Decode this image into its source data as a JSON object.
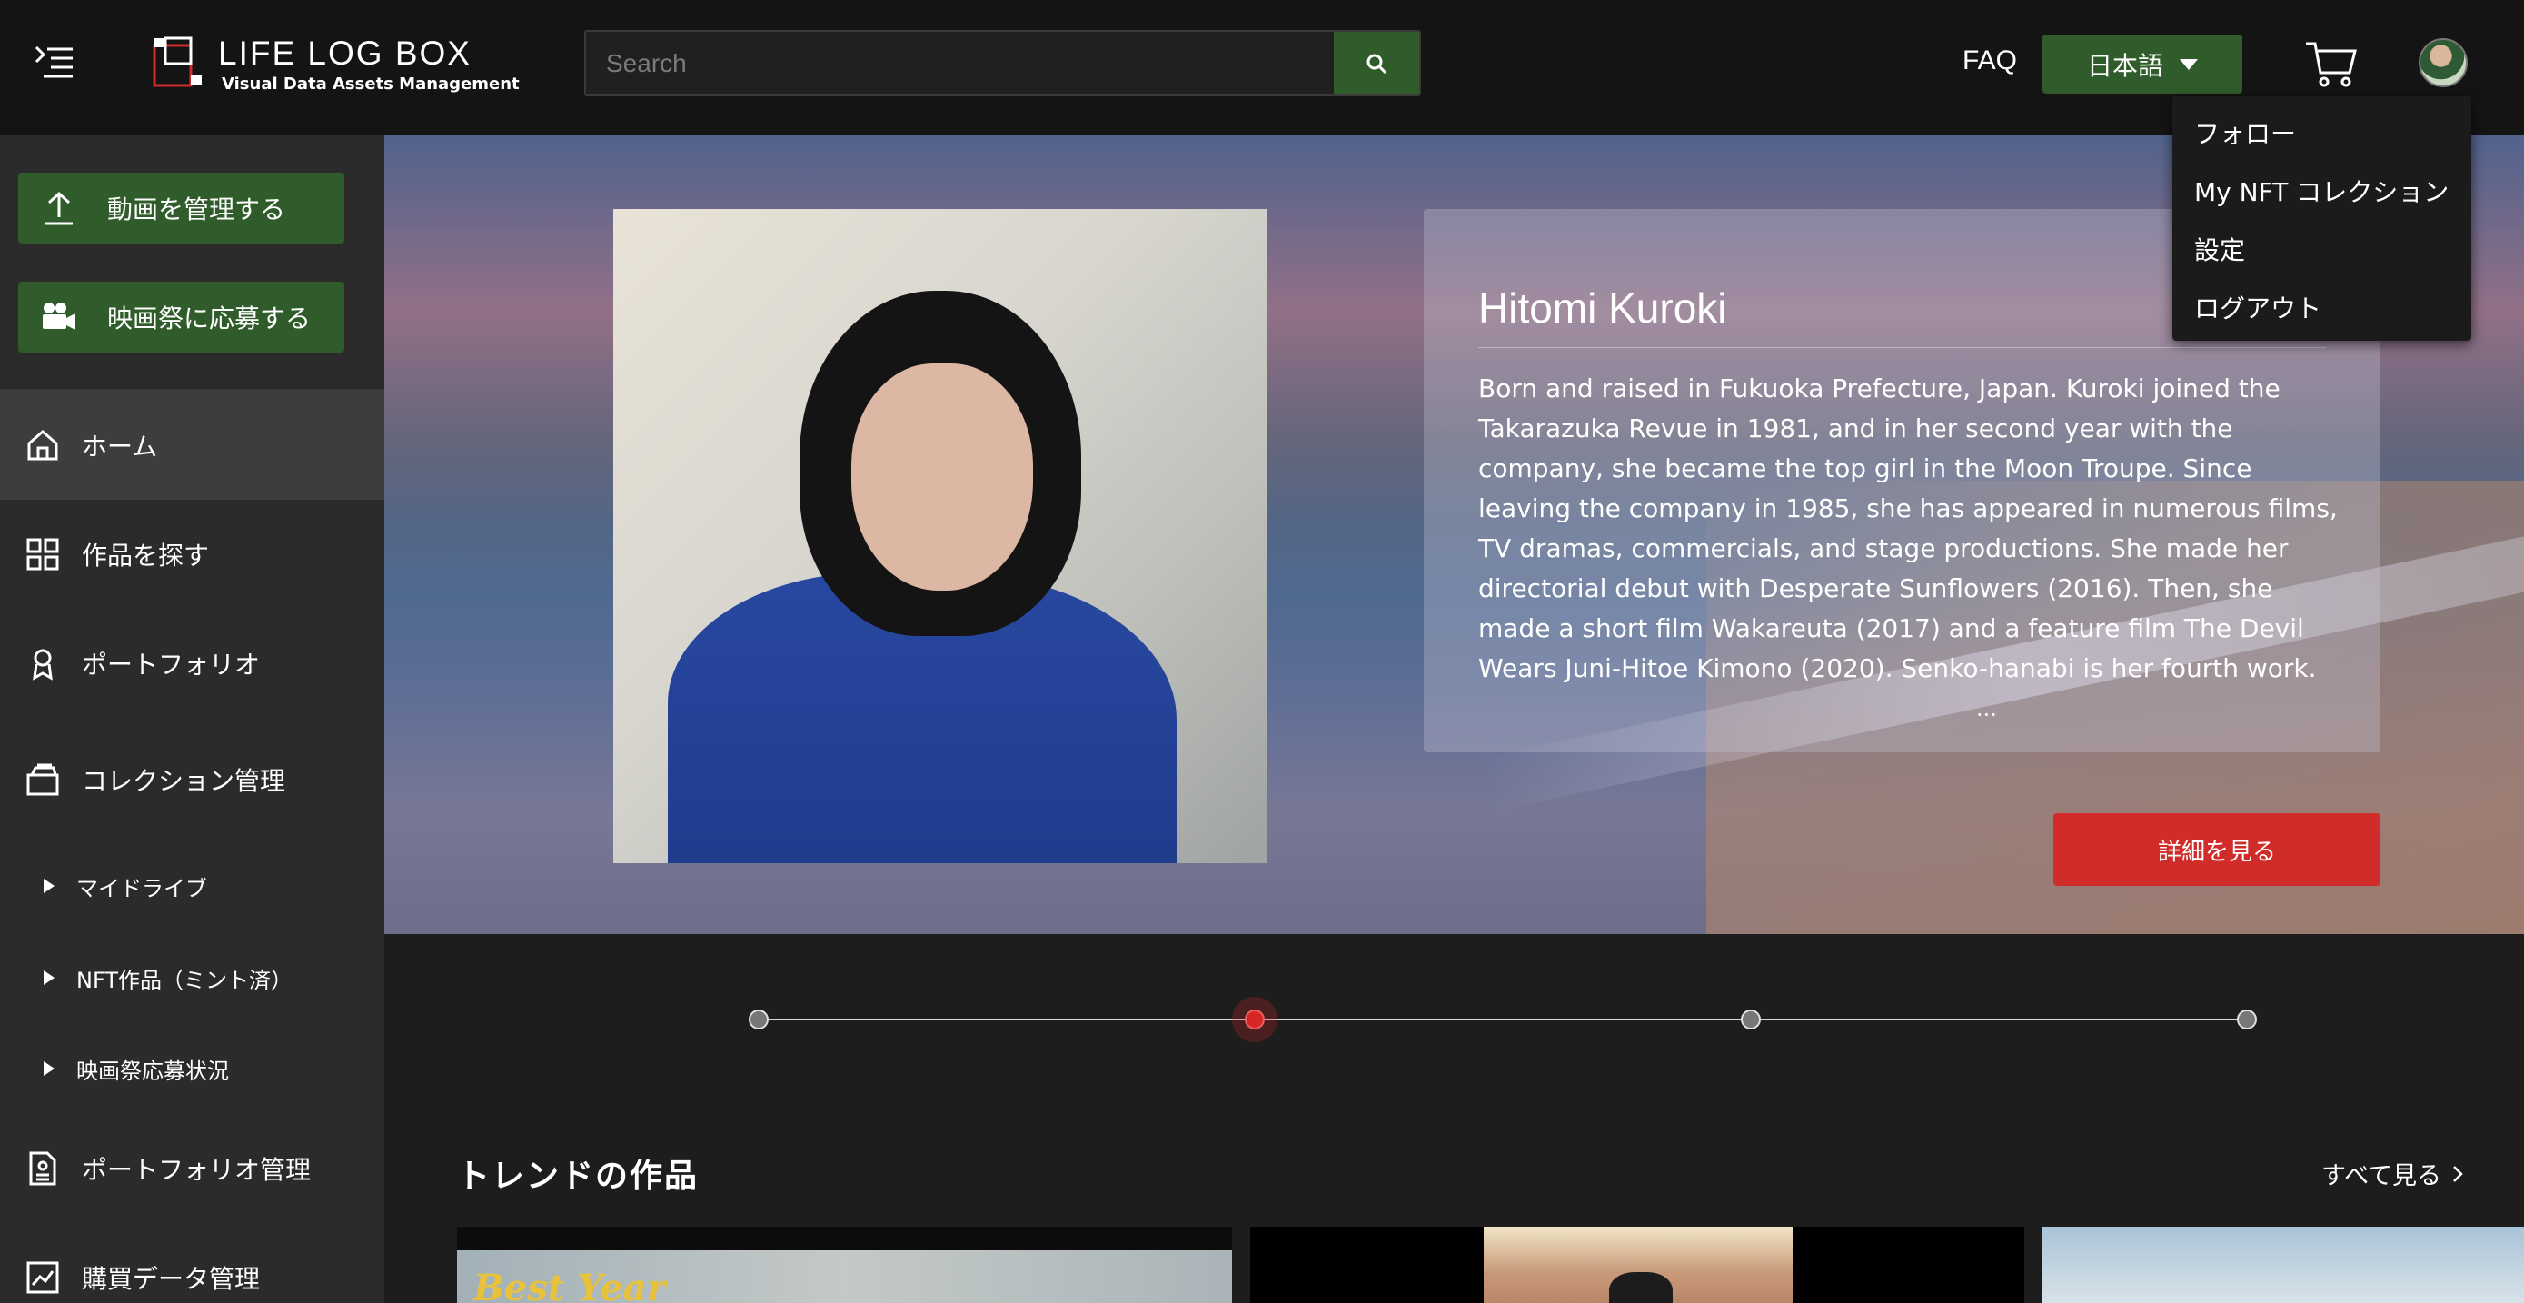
{
  "header": {
    "logo_title": "LIFE LOG BOX",
    "logo_subtitle": "Visual Data Assets Management",
    "search_placeholder": "Search",
    "faq_label": "FAQ",
    "language_label": "日本語"
  },
  "dropdown": {
    "items": [
      "フォロー",
      "My NFT コレクション",
      "設定",
      "ログアウト"
    ]
  },
  "sidebar": {
    "cta_manage_videos": "動画を管理する",
    "cta_apply_festival": "映画祭に応募する",
    "nav": [
      {
        "label": "ホーム",
        "active": true
      },
      {
        "label": "作品を探す"
      },
      {
        "label": "ポートフォリオ"
      },
      {
        "label": "コレクション管理"
      }
    ],
    "sub": [
      "マイドライブ",
      "NFT作品（ミント済）",
      "映画祭応募状況"
    ],
    "nav2": [
      "ポートフォリオ管理",
      "購買データ管理"
    ]
  },
  "hero": {
    "name": "Hitomi Kuroki",
    "bio": "Born and raised in Fukuoka Prefecture, Japan. Kuroki joined the Takarazuka Revue in 1981, and in her second year with the company, she became the top girl in the Moon Troupe. Since leaving the company in 1985, she has appeared in numerous films, TV dramas, commercials, and stage productions. She made her directorial debut with Desperate Sunflowers (2016). Then, she made a short film Wakareuta (2017) and a feature film The Devil Wears Juni-Hitoe Kimono (2020). Senko-hanabi is her fourth work.",
    "ellipsis": "...",
    "detail_button": "詳細を見る",
    "slides_count": 4,
    "active_slide": 2
  },
  "trending": {
    "title": "トレンドの作品",
    "see_all": "すべて見る",
    "cards": [
      {
        "visible_text": "Best Year"
      },
      {
        "visible_text": ""
      },
      {
        "visible_text": ""
      }
    ]
  },
  "colors": {
    "accent_green": "#2f5c2a",
    "accent_red": "#d02c2a",
    "header_bg": "#141414",
    "sidebar_bg": "#2b2b2b"
  }
}
